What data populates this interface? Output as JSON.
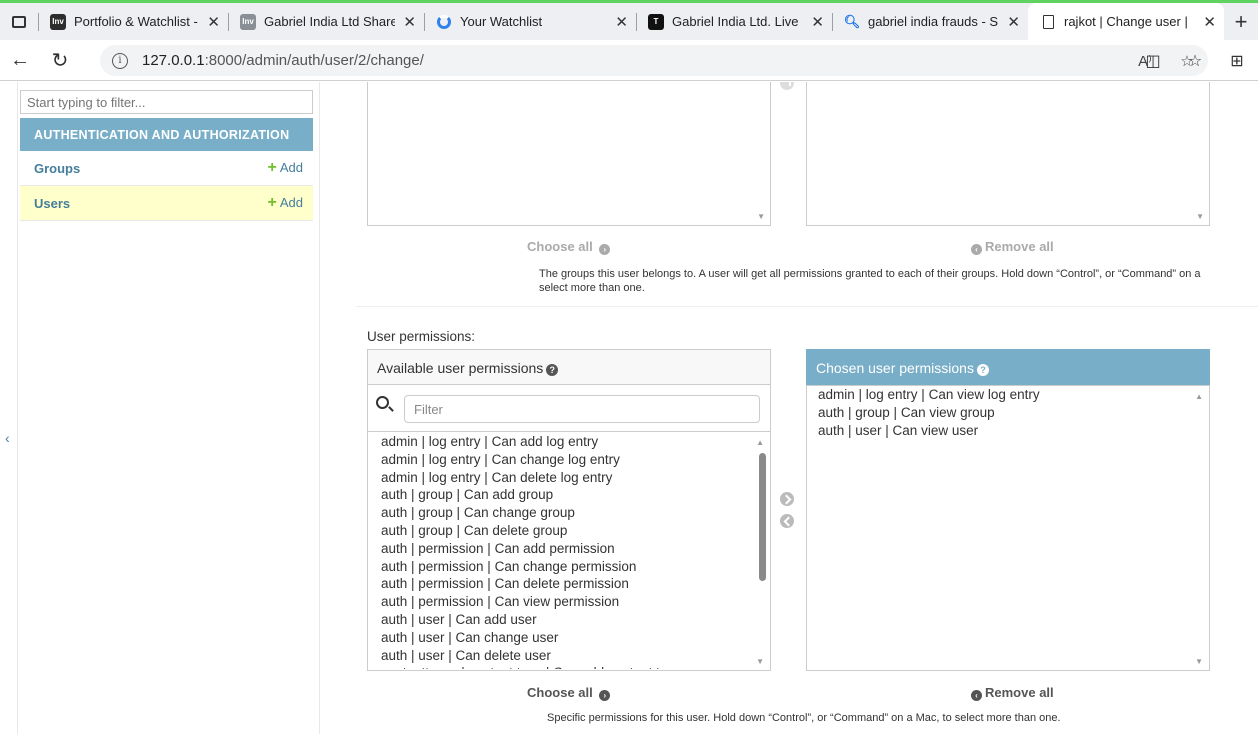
{
  "browser": {
    "tabs": [
      {
        "title": "Portfolio & Watchlist - ",
        "icon": "investing-favicon-icon"
      },
      {
        "title": "Gabriel India Ltd Share",
        "icon": "investing-favicon-icon"
      },
      {
        "title": "Your Watchlist",
        "icon": "loading-ring-icon"
      },
      {
        "title": "Gabriel India Ltd. Live ",
        "icon": "tradingview-favicon-icon"
      },
      {
        "title": "gabriel india frauds - S",
        "icon": "search-icon"
      },
      {
        "title": "rajkot | Change user | ",
        "icon": "page-icon"
      }
    ],
    "url_host": "127.0.0.1",
    "url_path": ":8000/admin/auth/user/2/change/",
    "reader_icon": "A⁾"
  },
  "sidebar": {
    "filter_placeholder": "Start typing to filter...",
    "module_caption": "AUTHENTICATION AND AUTHORIZATION",
    "models": [
      {
        "name": "Groups",
        "add_label": "Add"
      },
      {
        "name": "Users",
        "add_label": "Add"
      }
    ]
  },
  "groups_widget": {
    "choose_all": "Choose all",
    "remove_all": "Remove all",
    "help_line1": "The groups this user belongs to. A user will get all permissions granted to each of their groups. Hold down “Control”, or “Command” on a",
    "help_line2": "select more than one."
  },
  "permissions_widget": {
    "label": "User permissions:",
    "available_title": "Available user permissions",
    "chosen_title": "Chosen user permissions",
    "filter_placeholder": "Filter",
    "available_items": [
      "admin | log entry | Can add log entry",
      "admin | log entry | Can change log entry",
      "admin | log entry | Can delete log entry",
      "auth | group | Can add group",
      "auth | group | Can change group",
      "auth | group | Can delete group",
      "auth | permission | Can add permission",
      "auth | permission | Can change permission",
      "auth | permission | Can delete permission",
      "auth | permission | Can view permission",
      "auth | user | Can add user",
      "auth | user | Can change user",
      "auth | user | Can delete user",
      "contenttypes | content type | Can add content type"
    ],
    "chosen_items": [
      "admin | log entry | Can view log entry",
      "auth | group | Can view group",
      "auth | user | Can view user"
    ],
    "choose_all": "Choose all",
    "remove_all": "Remove all",
    "help": "Specific permissions for this user. Hold down “Control”, or “Command” on a Mac, to select more than one."
  }
}
